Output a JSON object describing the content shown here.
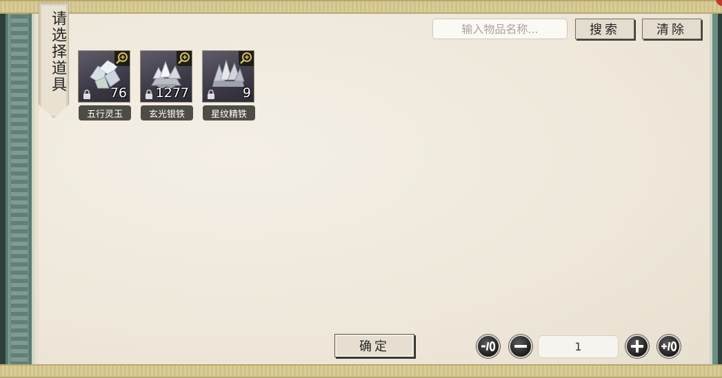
{
  "title": "请选择道具",
  "search": {
    "placeholder": "输入物品名称...",
    "search_label": "搜索",
    "clear_label": "清除"
  },
  "items": [
    {
      "name": "五行灵玉",
      "count": "76",
      "icon": "crystal-icon"
    },
    {
      "name": "玄光银铁",
      "count": "1277",
      "icon": "ore-icon"
    },
    {
      "name": "星纹精铁",
      "count": "9",
      "icon": "ore-icon"
    }
  ],
  "confirm_label": "确定",
  "quantity": {
    "value": "1",
    "minus10_label": "-10",
    "minus1_label": "-",
    "plus1_label": "+",
    "plus10_label": "+10"
  }
}
